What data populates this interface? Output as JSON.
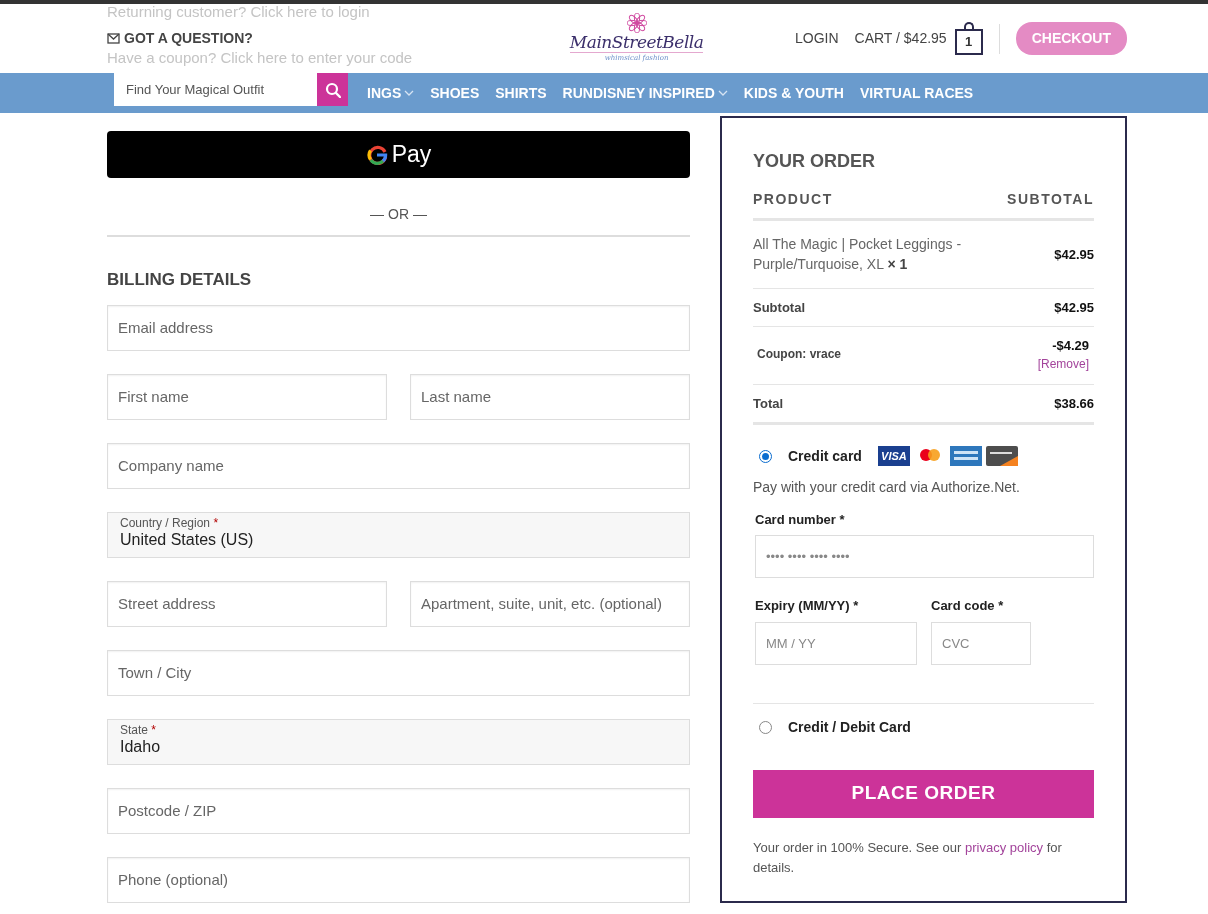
{
  "notices": [
    "Returning customer? Click here to login",
    "Have a coupon? Click here to enter your code"
  ],
  "header": {
    "question": "GOT A QUESTION?",
    "logo": {
      "name": "MainStreetBella",
      "tagline": "whimsical fashion"
    },
    "login": "LOGIN",
    "cart": {
      "label": "CART / $42.95",
      "count": "1"
    },
    "checkout_button": "CHECKOUT"
  },
  "nav": [
    {
      "label": "INGS",
      "dropdown": true
    },
    {
      "label": "SHOES",
      "dropdown": false
    },
    {
      "label": "SHIRTS",
      "dropdown": false
    },
    {
      "label": "RUNDISNEY INSPIRED",
      "dropdown": true
    },
    {
      "label": "KIDS & YOUTH",
      "dropdown": false
    },
    {
      "label": "VIRTUAL RACES",
      "dropdown": false
    }
  ],
  "search": {
    "placeholder": "Find Your Magical Outfit"
  },
  "express_pay": {
    "label": "Pay"
  },
  "separator": "— OR —",
  "billing": {
    "title": "BILLING DETAILS",
    "rows": [
      [
        {
          "placeholder": "Email address"
        }
      ],
      [
        {
          "placeholder": "First name"
        },
        {
          "placeholder": "Last name"
        }
      ],
      [
        {
          "placeholder": "Company name"
        }
      ],
      [
        {
          "label": "Country / Region",
          "required": "*",
          "value": "United States (US)"
        }
      ],
      [
        {
          "placeholder": "Street address"
        },
        {
          "placeholder": "Apartment, suite, unit, etc. (optional)"
        }
      ],
      [
        {
          "placeholder": "Town / City"
        }
      ],
      [
        {
          "label": "State",
          "required": "*",
          "value": "Idaho"
        }
      ],
      [
        {
          "placeholder": "Postcode / ZIP"
        }
      ],
      [
        {
          "placeholder": "Phone (optional)"
        }
      ]
    ]
  },
  "order": {
    "title": "YOUR ORDER",
    "columns": [
      "PRODUCT",
      "SUBTOTAL"
    ],
    "items": [
      {
        "name": "All The Magic | Pocket Leggings - Purple/Turquoise, XL",
        "quantity": "× 1",
        "price": "$42.95"
      }
    ],
    "subtotal": {
      "label": "Subtotal",
      "value": "$42.95"
    },
    "coupon": {
      "label": "Coupon: vrace",
      "value": "-$4.29",
      "action": "[Remove]"
    },
    "total": {
      "label": "Total",
      "value": "$38.66"
    }
  },
  "payment_methods": [
    {
      "label": "Credit card",
      "selected": true,
      "card_logos": [
        {
          "kind": "visa",
          "text": "VISA"
        },
        {
          "kind": "mastercard"
        },
        {
          "kind": "amex"
        },
        {
          "kind": "discover"
        }
      ],
      "description": "Pay with your credit card via Authorize.Net.",
      "fields": [
        {
          "kind": "wide",
          "label": "Card number *",
          "placeholder": "•••• •••• •••• ••••"
        },
        {
          "kind": "expiry",
          "label": "Expiry (MM/YY) *",
          "placeholder": "MM / YY"
        },
        {
          "kind": "code",
          "label": "Card code *",
          "placeholder": "CVC"
        }
      ]
    },
    {
      "label": "Credit / Debit Card",
      "selected": false
    }
  ],
  "place_order": "PLACE ORDER",
  "secure_note": {
    "before": "Your order in 100% Secure. See our ",
    "link": "privacy policy",
    "after": " for details."
  }
}
